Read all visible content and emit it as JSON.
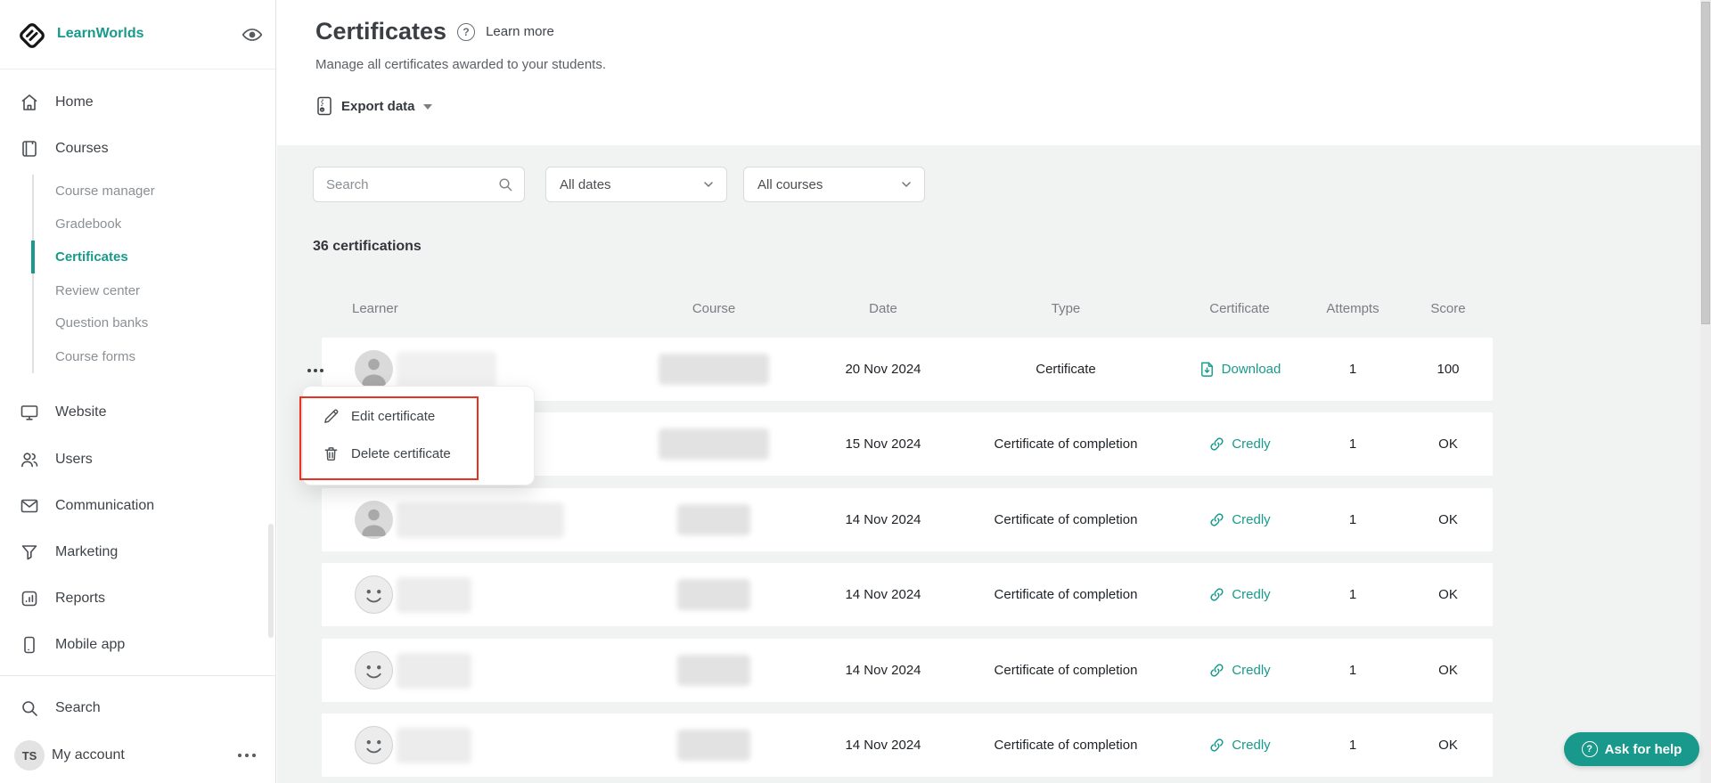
{
  "brand": {
    "name": "LearnWorlds",
    "teal": "#18998b"
  },
  "icons": {
    "question_glyph": "?"
  },
  "sidebar": {
    "logo_label": "LearnWorlds",
    "nav": [
      {
        "label": "Home"
      },
      {
        "label": "Courses"
      },
      {
        "label": "Website"
      },
      {
        "label": "Users"
      },
      {
        "label": "Communication"
      },
      {
        "label": "Marketing"
      },
      {
        "label": "Reports"
      },
      {
        "label": "Mobile app"
      }
    ],
    "courses_sub": [
      {
        "label": "Course manager",
        "active": false
      },
      {
        "label": "Gradebook",
        "active": false
      },
      {
        "label": "Certificates",
        "active": true
      },
      {
        "label": "Review center",
        "active": false
      },
      {
        "label": "Question banks",
        "active": false
      },
      {
        "label": "Course forms",
        "active": false
      }
    ],
    "search_label": "Search",
    "account": {
      "label": "My account",
      "initials": "TS"
    }
  },
  "header": {
    "title": "Certificates",
    "learn_more_label": "Learn more",
    "subtitle": "Manage all certificates awarded to your students.",
    "export_label": "Export data"
  },
  "filters": {
    "search_placeholder": "Search",
    "dates_value": "All dates",
    "courses_value": "All courses"
  },
  "summary_count": "36 certifications",
  "table": {
    "columns": [
      "Learner",
      "Course",
      "Date",
      "Type",
      "Certificate",
      "Attempts",
      "Score"
    ],
    "rows": [
      {
        "avatar": "person",
        "learner_blurred": true,
        "course_blurred": true,
        "date": "20 Nov 2024",
        "type": "Certificate",
        "cert_label": "Download",
        "cert_icon": "pdf-download",
        "attempts": "1",
        "score": "100"
      },
      {
        "avatar": "person",
        "learner_blurred": true,
        "course_blurred": true,
        "date": "15 Nov 2024",
        "type": "Certificate of completion",
        "cert_label": "Credly",
        "cert_icon": "link",
        "attempts": "1",
        "score": "OK"
      },
      {
        "avatar": "person",
        "learner_blurred": true,
        "course_blurred": true,
        "date": "14 Nov 2024",
        "type": "Certificate of completion",
        "cert_label": "Credly",
        "cert_icon": "link",
        "attempts": "1",
        "score": "OK"
      },
      {
        "avatar": "smiley",
        "learner_blurred": true,
        "course_blurred": true,
        "date": "14 Nov 2024",
        "type": "Certificate of completion",
        "cert_label": "Credly",
        "cert_icon": "link",
        "attempts": "1",
        "score": "OK"
      },
      {
        "avatar": "smiley",
        "learner_blurred": true,
        "course_blurred": true,
        "date": "14 Nov 2024",
        "type": "Certificate of completion",
        "cert_label": "Credly",
        "cert_icon": "link",
        "attempts": "1",
        "score": "OK"
      },
      {
        "avatar": "smiley",
        "learner_blurred": true,
        "course_blurred": true,
        "date": "14 Nov 2024",
        "type": "Certificate of completion",
        "cert_label": "Credly",
        "cert_icon": "link",
        "attempts": "1",
        "score": "OK"
      }
    ]
  },
  "context_menu": {
    "highlight_color": "#ea3223",
    "items": [
      {
        "label": "Edit certificate",
        "icon": "pencil"
      },
      {
        "label": "Delete certificate",
        "icon": "trash"
      }
    ]
  },
  "help_button_label": "Ask for help"
}
